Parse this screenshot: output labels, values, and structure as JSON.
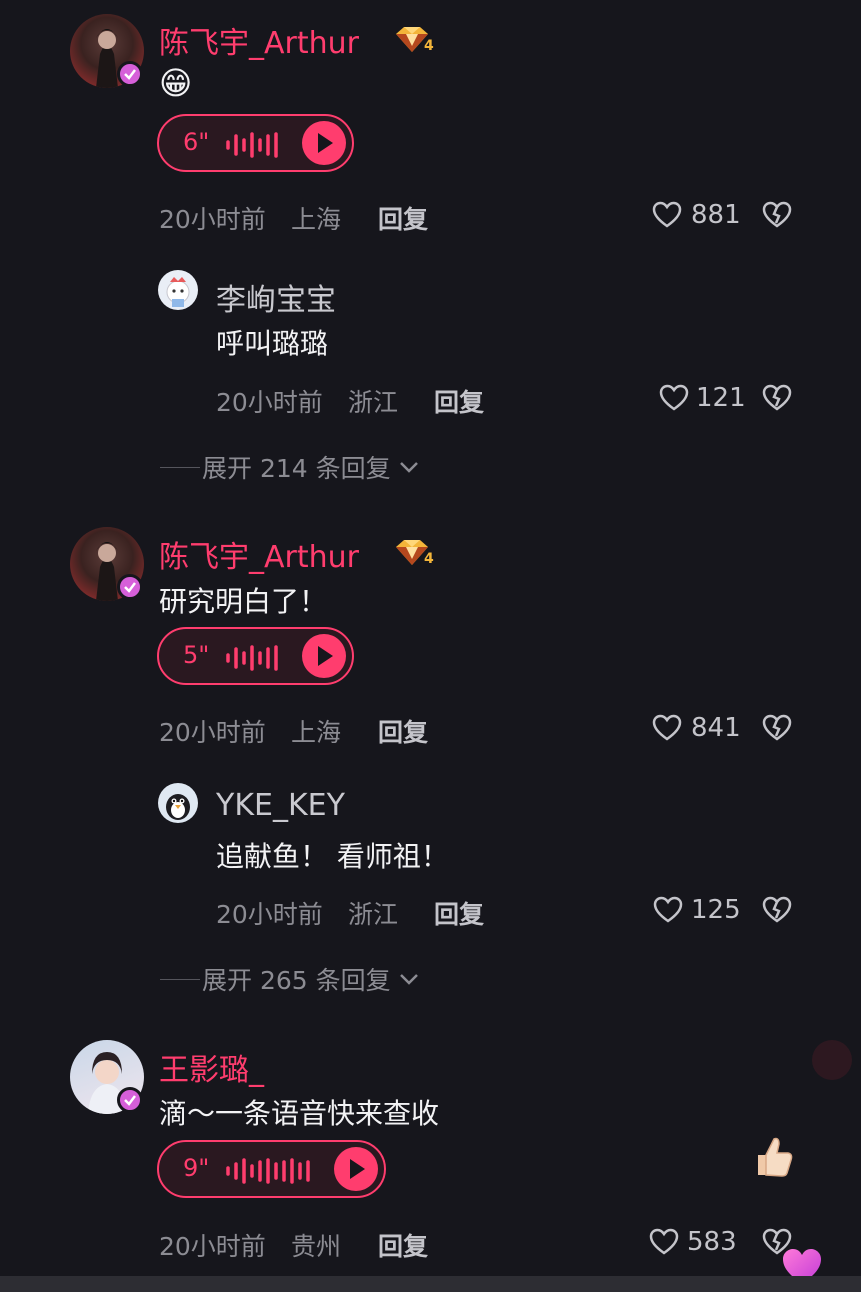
{
  "comments": [
    {
      "name": "陈飞宇_Arthur",
      "level": "4",
      "text": "😁",
      "voice_duration": "6\"",
      "time": "20小时前",
      "location": "上海",
      "reply_label": "回复",
      "likes": "881",
      "reply": {
        "name": "李峋宝宝",
        "text": "呼叫璐璐",
        "time": "20小时前",
        "location": "浙江",
        "reply_label": "回复",
        "likes": "121"
      },
      "expand": "展开 214 条回复"
    },
    {
      "name": "陈飞宇_Arthur",
      "level": "4",
      "text": "研究明白了！",
      "voice_duration": "5\"",
      "time": "20小时前",
      "location": "上海",
      "reply_label": "回复",
      "likes": "841",
      "reply": {
        "name": "YKE_KEY",
        "text": "追献鱼！ 看师祖！",
        "time": "20小时前",
        "location": "浙江",
        "reply_label": "回复",
        "likes": "125"
      },
      "expand": "展开 265 条回复"
    },
    {
      "name": "王影璐_",
      "text": "滴～一条语音快来查收",
      "voice_duration": "9\"",
      "time": "20小时前",
      "location": "贵州",
      "reply_label": "回复",
      "likes": "583"
    }
  ],
  "colors": {
    "background": "#16161c",
    "accent": "#ff3d6e",
    "verified": "#d65fd9"
  },
  "icons": [
    "heart-icon",
    "dislike-heart-icon",
    "play-icon",
    "chevron-down-icon",
    "verified-icon",
    "level-diamond-icon",
    "thumbs-up-icon"
  ]
}
